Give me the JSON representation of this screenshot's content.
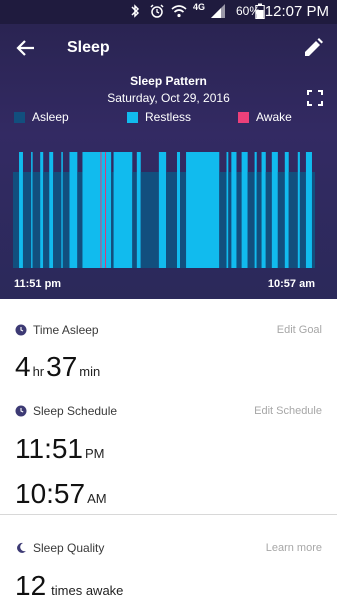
{
  "status_bar": {
    "time": "12:07 PM",
    "battery": "60%",
    "network": "4G",
    "icons": [
      "bluetooth-icon",
      "alarm-icon",
      "wifi-icon",
      "signal-icon",
      "battery-icon"
    ]
  },
  "header": {
    "title": "Sleep",
    "back_icon": "arrow-left-icon",
    "edit_icon": "pencil-icon"
  },
  "chart": {
    "title": "Sleep Pattern",
    "date": "Saturday, Oct 29, 2016",
    "expand_icon": "fullscreen-icon",
    "legend": [
      {
        "label": "Asleep",
        "color": "#124f7e"
      },
      {
        "label": "Restless",
        "color": "#11bbee"
      },
      {
        "label": "Awake",
        "color": "#ec407a"
      }
    ],
    "start_label": "11:51 pm",
    "end_label": "10:57 am"
  },
  "chart_data": {
    "type": "bar",
    "x_start": "11:51 pm",
    "x_end": "10:57 am",
    "series_names": [
      "Asleep",
      "Restless",
      "Awake"
    ],
    "segments": [
      {
        "state": "asleep",
        "start": 0.0,
        "end": 0.02
      },
      {
        "state": "restless",
        "start": 0.02,
        "end": 0.033
      },
      {
        "state": "asleep",
        "start": 0.033,
        "end": 0.06
      },
      {
        "state": "restless",
        "start": 0.06,
        "end": 0.065
      },
      {
        "state": "asleep",
        "start": 0.065,
        "end": 0.09
      },
      {
        "state": "restless",
        "start": 0.09,
        "end": 0.1
      },
      {
        "state": "asleep",
        "start": 0.1,
        "end": 0.12
      },
      {
        "state": "restless",
        "start": 0.12,
        "end": 0.133
      },
      {
        "state": "asleep",
        "start": 0.133,
        "end": 0.16
      },
      {
        "state": "restless",
        "start": 0.16,
        "end": 0.165
      },
      {
        "state": "asleep",
        "start": 0.165,
        "end": 0.187
      },
      {
        "state": "restless",
        "start": 0.187,
        "end": 0.213
      },
      {
        "state": "asleep",
        "start": 0.213,
        "end": 0.23
      },
      {
        "state": "restless",
        "start": 0.23,
        "end": 0.29
      },
      {
        "state": "awake",
        "start": 0.29,
        "end": 0.293
      },
      {
        "state": "restless",
        "start": 0.293,
        "end": 0.305
      },
      {
        "state": "awake",
        "start": 0.305,
        "end": 0.308
      },
      {
        "state": "restless",
        "start": 0.308,
        "end": 0.325
      },
      {
        "state": "asleep",
        "start": 0.325,
        "end": 0.333
      },
      {
        "state": "restless",
        "start": 0.333,
        "end": 0.395
      },
      {
        "state": "asleep",
        "start": 0.395,
        "end": 0.41
      },
      {
        "state": "restless",
        "start": 0.41,
        "end": 0.423
      },
      {
        "state": "asleep",
        "start": 0.423,
        "end": 0.483
      },
      {
        "state": "restless",
        "start": 0.483,
        "end": 0.507
      },
      {
        "state": "asleep",
        "start": 0.507,
        "end": 0.543
      },
      {
        "state": "restless",
        "start": 0.543,
        "end": 0.553
      },
      {
        "state": "asleep",
        "start": 0.553,
        "end": 0.573
      },
      {
        "state": "restless",
        "start": 0.573,
        "end": 0.683
      },
      {
        "state": "asleep",
        "start": 0.683,
        "end": 0.707
      },
      {
        "state": "restless",
        "start": 0.707,
        "end": 0.713
      },
      {
        "state": "asleep",
        "start": 0.713,
        "end": 0.723
      },
      {
        "state": "restless",
        "start": 0.723,
        "end": 0.74
      },
      {
        "state": "asleep",
        "start": 0.74,
        "end": 0.757
      },
      {
        "state": "restless",
        "start": 0.757,
        "end": 0.777
      },
      {
        "state": "asleep",
        "start": 0.777,
        "end": 0.8
      },
      {
        "state": "restless",
        "start": 0.8,
        "end": 0.807
      },
      {
        "state": "asleep",
        "start": 0.807,
        "end": 0.823
      },
      {
        "state": "restless",
        "start": 0.823,
        "end": 0.837
      },
      {
        "state": "asleep",
        "start": 0.837,
        "end": 0.857
      },
      {
        "state": "restless",
        "start": 0.857,
        "end": 0.877
      },
      {
        "state": "asleep",
        "start": 0.877,
        "end": 0.9
      },
      {
        "state": "restless",
        "start": 0.9,
        "end": 0.913
      },
      {
        "state": "asleep",
        "start": 0.913,
        "end": 0.943
      },
      {
        "state": "restless",
        "start": 0.943,
        "end": 0.95
      },
      {
        "state": "asleep",
        "start": 0.95,
        "end": 0.97
      },
      {
        "state": "restless",
        "start": 0.97,
        "end": 0.99
      },
      {
        "state": "asleep",
        "start": 0.99,
        "end": 1.0
      }
    ]
  },
  "time_asleep": {
    "label": "Time Asleep",
    "link": "Edit Goal",
    "hours": "4",
    "hours_unit": "hr",
    "minutes": "37",
    "minutes_unit": "min",
    "icon": "moon-clock-icon"
  },
  "sleep_schedule": {
    "label": "Sleep Schedule",
    "link": "Edit Schedule",
    "bedtime": "11:51",
    "bedtime_ampm": "PM",
    "waketime": "10:57",
    "waketime_ampm": "AM",
    "icon": "clock-icon"
  },
  "sleep_quality": {
    "label": "Sleep Quality",
    "link": "Learn more",
    "count": "12",
    "unit": "times awake",
    "icon": "moon-icon"
  }
}
